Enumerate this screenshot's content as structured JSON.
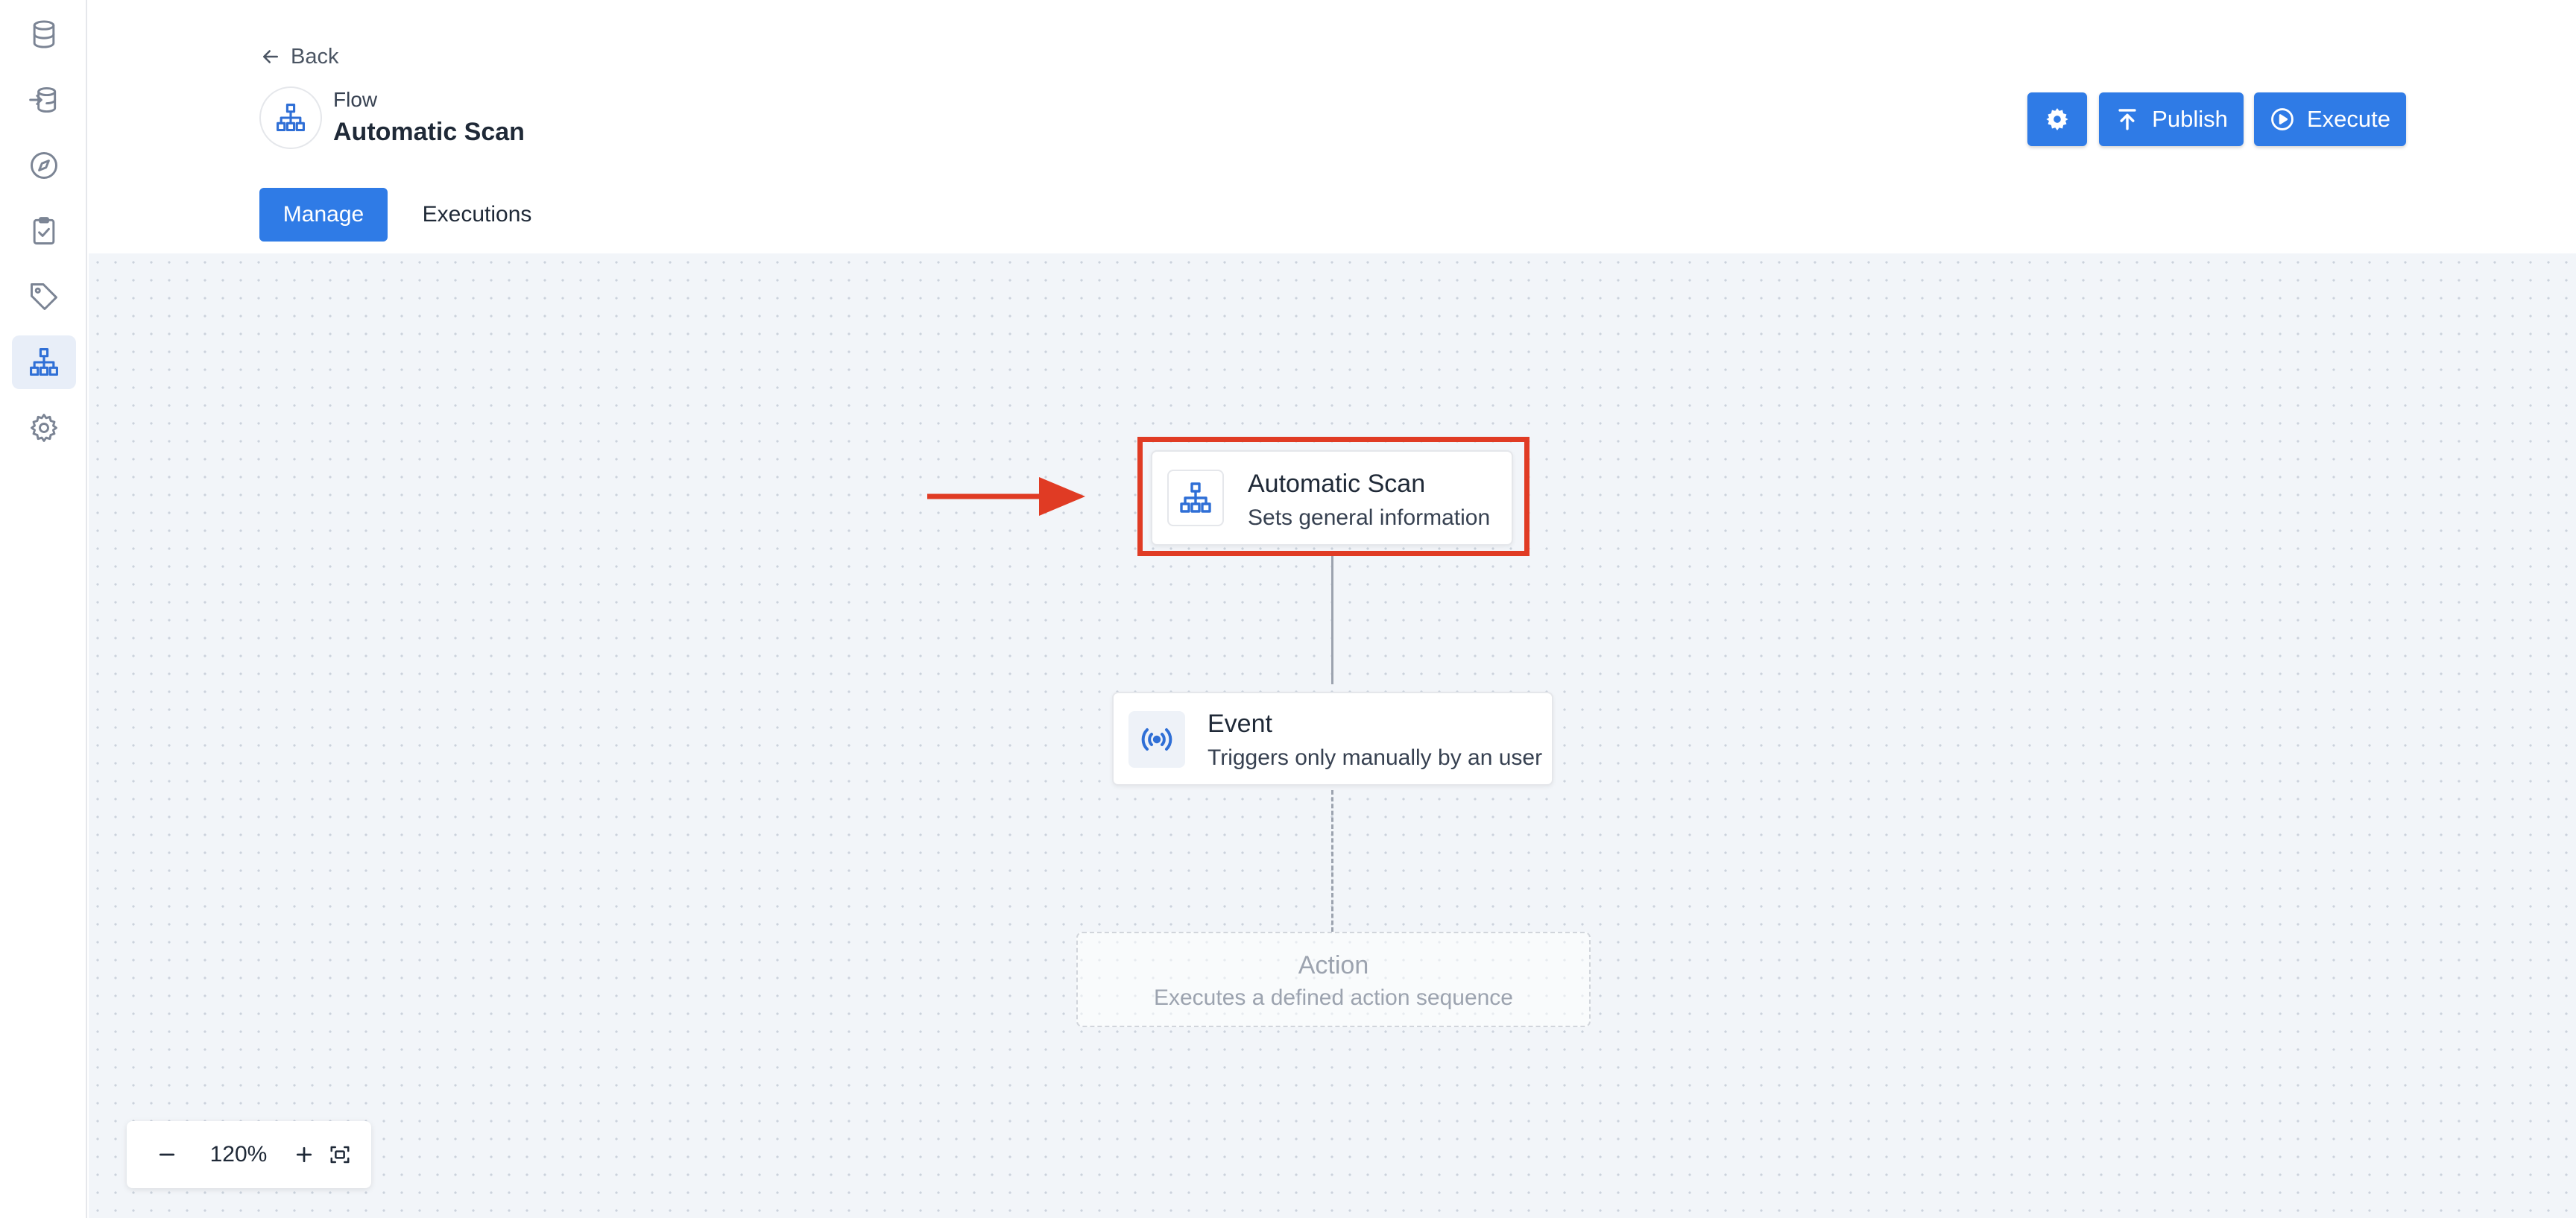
{
  "sidebar": {
    "items": [
      {
        "name": "database-icon",
        "active": false
      },
      {
        "name": "database-import-icon",
        "active": false
      },
      {
        "name": "compass-icon",
        "active": false
      },
      {
        "name": "clipboard-check-icon",
        "active": false
      },
      {
        "name": "tag-icon",
        "active": false
      },
      {
        "name": "sitemap-icon",
        "active": true
      },
      {
        "name": "gear-icon",
        "active": false
      }
    ]
  },
  "header": {
    "back_label": "Back",
    "kicker": "Flow",
    "title": "Automatic Scan",
    "buttons": {
      "settings_icon": "gear-icon",
      "publish_label": "Publish",
      "execute_label": "Execute"
    },
    "tabs": [
      {
        "label": "Manage",
        "active": true
      },
      {
        "label": "Executions",
        "active": false
      }
    ]
  },
  "canvas": {
    "nodes": {
      "scan": {
        "title": "Automatic Scan",
        "subtitle": "Sets general information",
        "icon": "sitemap-icon"
      },
      "event": {
        "title": "Event",
        "subtitle": "Triggers only manually by an user",
        "icon": "broadcast-icon"
      },
      "action": {
        "title": "Action",
        "subtitle": "Executes a defined action sequence"
      }
    },
    "zoom": {
      "level": "120%"
    }
  },
  "colors": {
    "accent": "#2f7be6",
    "highlight": "#e03b24",
    "canvas_bg": "#f2f5f9"
  }
}
